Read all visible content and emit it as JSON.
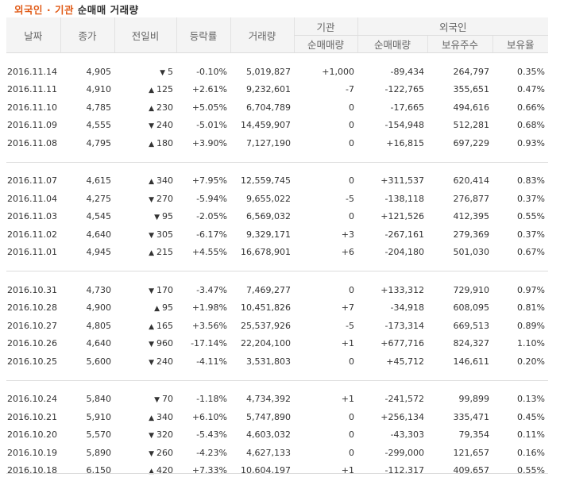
{
  "title": {
    "part1": "외국인 · 기관",
    "part2": " 순매매 거래량"
  },
  "headers": {
    "date": "날짜",
    "close": "종가",
    "change": "전일비",
    "rate": "등락률",
    "volume": "거래량",
    "inst": "기관",
    "foreign": "외국인",
    "inst_net": "순매매량",
    "foreign_net": "순매매량",
    "foreign_hold": "보유주수",
    "foreign_ratio": "보유율"
  },
  "groups": [
    [
      {
        "date": "2016.11.14",
        "close": "4,905",
        "dir": "down",
        "change": "5",
        "rate": "-0.10%",
        "volume": "5,019,827",
        "inst": "+1,000",
        "foreign": "-89,434",
        "hold": "264,797",
        "ratio": "0.35%"
      },
      {
        "date": "2016.11.11",
        "close": "4,910",
        "dir": "up",
        "change": "125",
        "rate": "+2.61%",
        "volume": "9,232,601",
        "inst": "-7",
        "foreign": "-122,765",
        "hold": "355,651",
        "ratio": "0.47%"
      },
      {
        "date": "2016.11.10",
        "close": "4,785",
        "dir": "up",
        "change": "230",
        "rate": "+5.05%",
        "volume": "6,704,789",
        "inst": "0",
        "foreign": "-17,665",
        "hold": "494,616",
        "ratio": "0.66%"
      },
      {
        "date": "2016.11.09",
        "close": "4,555",
        "dir": "down",
        "change": "240",
        "rate": "-5.01%",
        "volume": "14,459,907",
        "inst": "0",
        "foreign": "-154,948",
        "hold": "512,281",
        "ratio": "0.68%"
      },
      {
        "date": "2016.11.08",
        "close": "4,795",
        "dir": "up",
        "change": "180",
        "rate": "+3.90%",
        "volume": "7,127,190",
        "inst": "0",
        "foreign": "+16,815",
        "hold": "697,229",
        "ratio": "0.93%"
      }
    ],
    [
      {
        "date": "2016.11.07",
        "close": "4,615",
        "dir": "up",
        "change": "340",
        "rate": "+7.95%",
        "volume": "12,559,745",
        "inst": "0",
        "foreign": "+311,537",
        "hold": "620,414",
        "ratio": "0.83%"
      },
      {
        "date": "2016.11.04",
        "close": "4,275",
        "dir": "down",
        "change": "270",
        "rate": "-5.94%",
        "volume": "9,655,022",
        "inst": "-5",
        "foreign": "-138,118",
        "hold": "276,877",
        "ratio": "0.37%"
      },
      {
        "date": "2016.11.03",
        "close": "4,545",
        "dir": "down",
        "change": "95",
        "rate": "-2.05%",
        "volume": "6,569,032",
        "inst": "0",
        "foreign": "+121,526",
        "hold": "412,395",
        "ratio": "0.55%"
      },
      {
        "date": "2016.11.02",
        "close": "4,640",
        "dir": "down",
        "change": "305",
        "rate": "-6.17%",
        "volume": "9,329,171",
        "inst": "+3",
        "foreign": "-267,161",
        "hold": "279,369",
        "ratio": "0.37%"
      },
      {
        "date": "2016.11.01",
        "close": "4,945",
        "dir": "up",
        "change": "215",
        "rate": "+4.55%",
        "volume": "16,678,901",
        "inst": "+6",
        "foreign": "-204,180",
        "hold": "501,030",
        "ratio": "0.67%"
      }
    ],
    [
      {
        "date": "2016.10.31",
        "close": "4,730",
        "dir": "down",
        "change": "170",
        "rate": "-3.47%",
        "volume": "7,469,277",
        "inst": "0",
        "foreign": "+133,312",
        "hold": "729,910",
        "ratio": "0.97%"
      },
      {
        "date": "2016.10.28",
        "close": "4,900",
        "dir": "up",
        "change": "95",
        "rate": "+1.98%",
        "volume": "10,451,826",
        "inst": "+7",
        "foreign": "-34,918",
        "hold": "608,095",
        "ratio": "0.81%"
      },
      {
        "date": "2016.10.27",
        "close": "4,805",
        "dir": "up",
        "change": "165",
        "rate": "+3.56%",
        "volume": "25,537,926",
        "inst": "-5",
        "foreign": "-173,314",
        "hold": "669,513",
        "ratio": "0.89%"
      },
      {
        "date": "2016.10.26",
        "close": "4,640",
        "dir": "down",
        "change": "960",
        "rate": "-17.14%",
        "volume": "22,204,100",
        "inst": "+1",
        "foreign": "+677,716",
        "hold": "824,327",
        "ratio": "1.10%"
      },
      {
        "date": "2016.10.25",
        "close": "5,600",
        "dir": "down",
        "change": "240",
        "rate": "-4.11%",
        "volume": "3,531,803",
        "inst": "0",
        "foreign": "+45,712",
        "hold": "146,611",
        "ratio": "0.20%"
      }
    ],
    [
      {
        "date": "2016.10.24",
        "close": "5,840",
        "dir": "down",
        "change": "70",
        "rate": "-1.18%",
        "volume": "4,734,392",
        "inst": "+1",
        "foreign": "-241,572",
        "hold": "99,899",
        "ratio": "0.13%"
      },
      {
        "date": "2016.10.21",
        "close": "5,910",
        "dir": "up",
        "change": "340",
        "rate": "+6.10%",
        "volume": "5,747,890",
        "inst": "0",
        "foreign": "+256,134",
        "hold": "335,471",
        "ratio": "0.45%"
      },
      {
        "date": "2016.10.20",
        "close": "5,570",
        "dir": "down",
        "change": "320",
        "rate": "-5.43%",
        "volume": "4,603,032",
        "inst": "0",
        "foreign": "-43,303",
        "hold": "79,354",
        "ratio": "0.11%"
      },
      {
        "date": "2016.10.19",
        "close": "5,890",
        "dir": "down",
        "change": "260",
        "rate": "-4.23%",
        "volume": "4,627,133",
        "inst": "0",
        "foreign": "-299,000",
        "hold": "121,657",
        "ratio": "0.16%"
      },
      {
        "date": "2016.10.18",
        "close": "6,150",
        "dir": "up",
        "change": "420",
        "rate": "+7.33%",
        "volume": "10,604,197",
        "inst": "+1",
        "foreign": "-112,317",
        "hold": "409,657",
        "ratio": "0.55%"
      }
    ]
  ],
  "colors": {
    "accent": "#e15b17",
    "rise": "#d11a1a",
    "fall": "#1a6bd1",
    "header_bg": "#f4f4f4"
  }
}
